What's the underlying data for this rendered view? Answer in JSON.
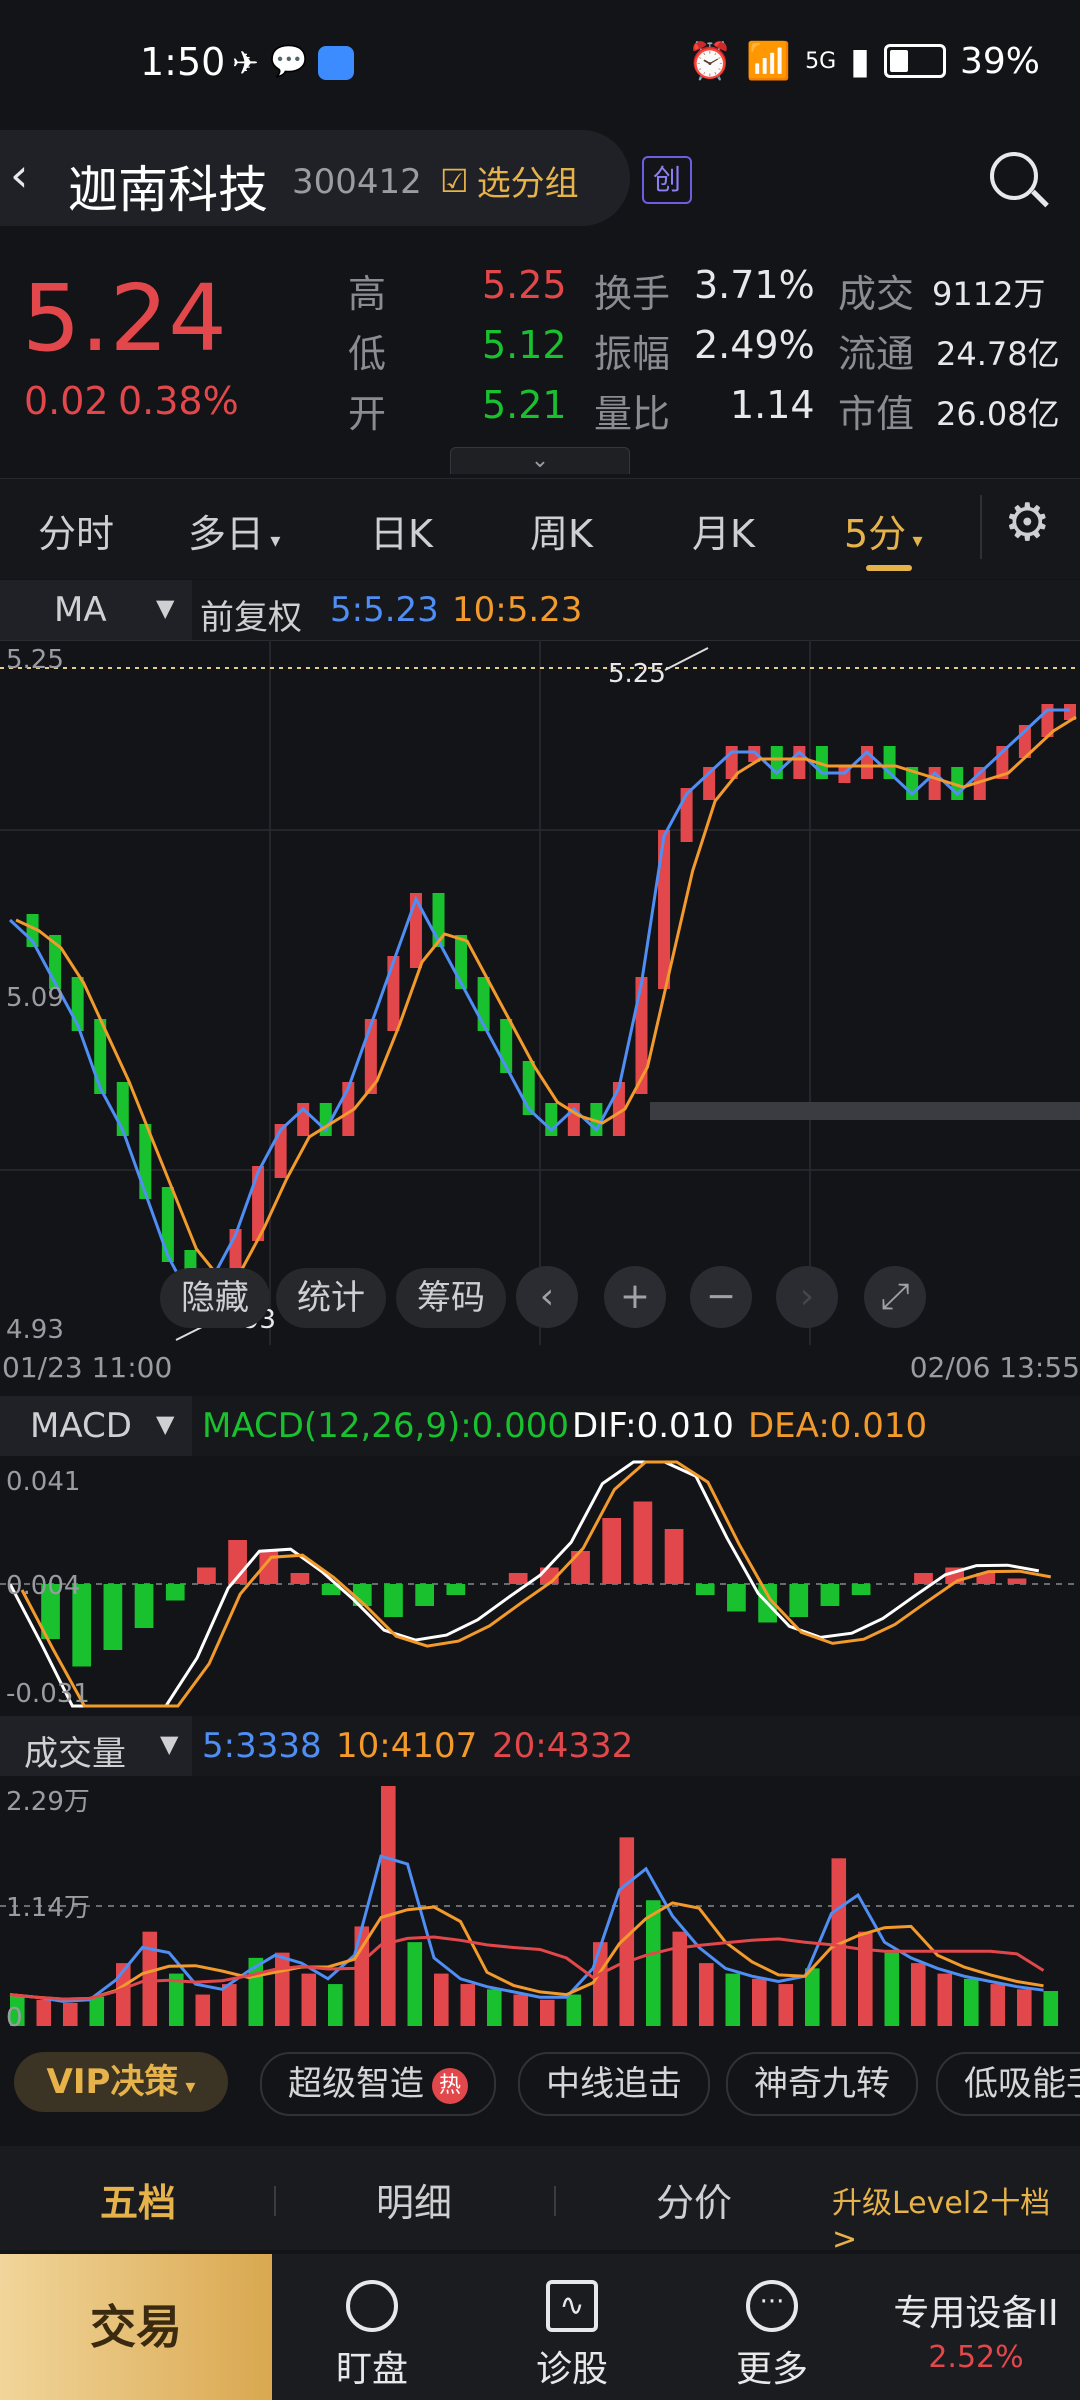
{
  "status": {
    "time": "1:50",
    "battery": "39%",
    "net": "5G"
  },
  "header": {
    "name": "迦南科技",
    "code": "300412",
    "group_btn": "选分组",
    "board_badge": "创"
  },
  "quote": {
    "price": "5.24",
    "change": "0.02",
    "change_pct": "0.38%",
    "high_label": "高",
    "high": "5.25",
    "low_label": "低",
    "low": "5.12",
    "open_label": "开",
    "open": "5.21",
    "turnover_label": "换手",
    "turnover": "3.71%",
    "amplitude_label": "振幅",
    "amplitude": "2.49%",
    "vol_ratio_label": "量比",
    "vol_ratio": "1.14",
    "amount_label": "成交",
    "amount": "9112万",
    "float_label": "流通",
    "float_cap": "24.78亿",
    "mcap_label": "市值",
    "mcap": "26.08亿"
  },
  "tabs": [
    "分时",
    "多日",
    "日K",
    "周K",
    "月K",
    "5分"
  ],
  "main_chart": {
    "indicator": "MA",
    "adjust": "前复权",
    "ma5": "5:5.23",
    "ma10": "10:5.23",
    "max_label": "5.25",
    "mid_label": "5.09",
    "min_label": "4.93",
    "high_marker": "5.25",
    "low_marker": "4.93",
    "start_time": "01/23 11:00",
    "end_time": "02/06 13:55",
    "buttons": [
      "隐藏",
      "统计",
      "筹码"
    ]
  },
  "macd": {
    "indicator": "MACD",
    "params": "MACD(12,26,9):0.000",
    "dif": "DIF:0.010",
    "dea": "DEA:0.010",
    "top_label": "0.041",
    "zero_label": "0.004",
    "bottom_label": "-0.031"
  },
  "volume": {
    "indicator": "成交量",
    "ma5": "5:3338",
    "ma10": "10:4107",
    "ma20": "20:4332",
    "top_label": "2.29万",
    "mid_label": "1.14万",
    "zero_label": "0"
  },
  "strategy": {
    "vip": "VIP决策",
    "items": [
      "超级智造",
      "中线追击",
      "神奇九转",
      "低吸能手"
    ],
    "hot_badge": "热"
  },
  "level_tabs": {
    "t1": "五档",
    "t2": "明细",
    "t3": "分价",
    "upgrade": "升级Level2十档 >"
  },
  "nav": {
    "trade": "交易",
    "watch": "盯盘",
    "diagnose": "诊股",
    "more": "更多",
    "device": "专用设备II",
    "device_pct": "2.52%"
  },
  "colors": {
    "up": "#e2484b",
    "down": "#19c12f",
    "accent": "#e6b24a",
    "ma5": "#4f8ef5",
    "ma10": "#f39a2c",
    "ma20": "#e2484b",
    "dif": "#ffffff",
    "dea": "#f39a2c"
  },
  "chart_data": [
    {
      "type": "line",
      "title": "",
      "series": [
        {
          "name": "5",
          "values": [
            5.13,
            5.12,
            5.1,
            5.08,
            5.05,
            5.03,
            5.0,
            4.97,
            4.95,
            4.96,
            4.98,
            5.01,
            5.03,
            5.04,
            5.03,
            5.05,
            5.08,
            5.11,
            5.14,
            5.12,
            5.1,
            5.08,
            5.06,
            5.04,
            5.03,
            5.04,
            5.03,
            5.05,
            5.1,
            5.17,
            5.19,
            5.2,
            5.21,
            5.21,
            5.2,
            5.21,
            5.2,
            5.2,
            5.21,
            5.2,
            5.19,
            5.2,
            5.19,
            5.2,
            5.21,
            5.22,
            5.23,
            5.23
          ]
        }
      ],
      "ylim": [
        4.93,
        5.25
      ]
    },
    {
      "type": "bar",
      "title": "",
      "series": [
        {
          "name": "MACD(12,26,9)",
          "values": [
            0.0,
            -0.01,
            -0.015,
            -0.012,
            -0.008,
            -0.003,
            0.003,
            0.008,
            0.006,
            0.002,
            -0.002,
            -0.004,
            -0.006,
            -0.004,
            -0.002,
            0.0,
            0.002,
            0.003,
            0.006,
            0.012,
            0.015,
            0.01,
            -0.002,
            -0.005,
            -0.007,
            -0.006,
            -0.004,
            -0.002,
            0.0,
            0.002,
            0.003,
            0.002,
            0.001,
            0.0
          ]
        }
      ],
      "ylim": [
        -0.031,
        0.041
      ]
    },
    {
      "type": "bar",
      "title": "",
      "series": [
        {
          "name": "成交量",
          "values": [
            3000,
            2500,
            2200,
            2800,
            6000,
            9000,
            5000,
            3000,
            4000,
            6500,
            7000,
            5000,
            4000,
            9500,
            22900,
            8000,
            5000,
            4000,
            3500,
            3000,
            2500,
            3000,
            8000,
            18000,
            12000,
            9000,
            6000,
            5000,
            4500,
            4000,
            5500,
            16000,
            9000,
            7000,
            6000,
            5000,
            4500,
            4000,
            3500,
            3338
          ]
        }
      ],
      "ylim": [
        0,
        22900
      ]
    }
  ]
}
